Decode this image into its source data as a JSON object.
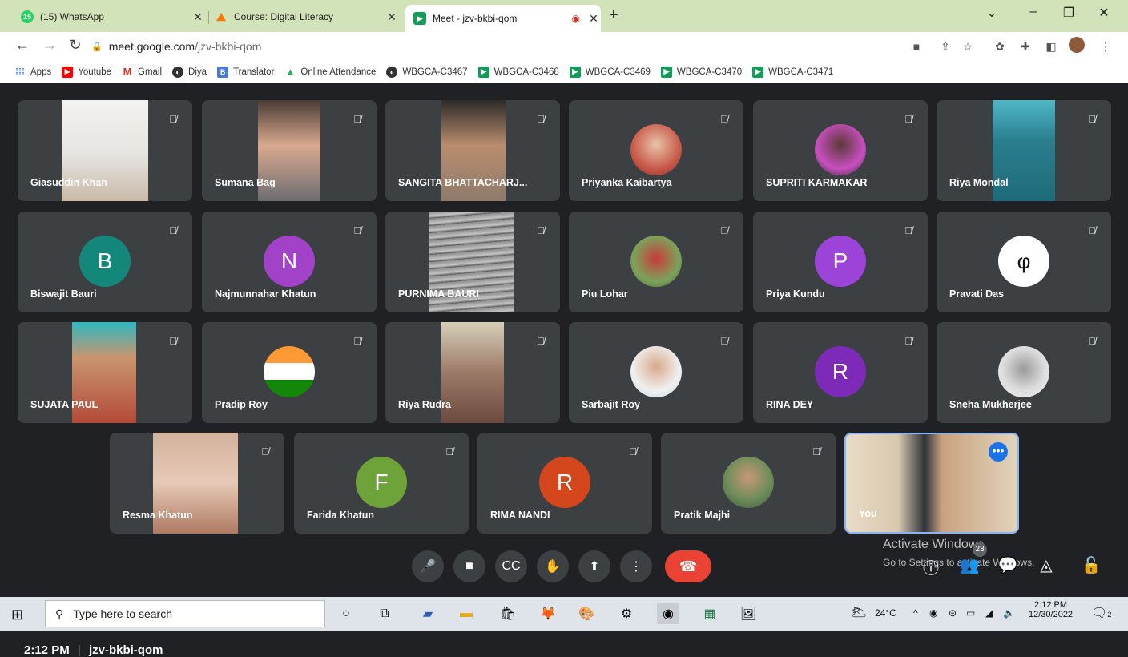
{
  "browser": {
    "tabs": [
      {
        "title": "(15) WhatsApp",
        "badge": "15"
      },
      {
        "title": "Course: Digital Literacy"
      },
      {
        "title": "Meet - jzv-bkbi-qom"
      }
    ],
    "url_host": "meet.google.com",
    "url_path": "/jzv-bkbi-qom",
    "bookmarks": [
      "Apps",
      "Youtube",
      "Gmail",
      "Diya",
      "Translator",
      "Online Attendance",
      "WBGCA-C3467",
      "WBGCA-C3468",
      "WBGCA-C3469",
      "WBGCA-C3470",
      "WBGCA-C3471"
    ]
  },
  "meet": {
    "participants": [
      {
        "name": "Giasuddin Khan",
        "initial": "",
        "color": ""
      },
      {
        "name": "Sumana Bag",
        "initial": "",
        "color": ""
      },
      {
        "name": "SANGITA BHATTACHARJ...",
        "initial": "",
        "color": ""
      },
      {
        "name": "Priyanka Kaibartya",
        "initial": "",
        "color": ""
      },
      {
        "name": "SUPRITI KARMAKAR",
        "initial": "",
        "color": ""
      },
      {
        "name": "Riya Mondal",
        "initial": "",
        "color": ""
      },
      {
        "name": "Biswajit Bauri",
        "initial": "B",
        "color": "#13887a"
      },
      {
        "name": "Najmunnahar Khatun",
        "initial": "N",
        "color": "#a142c8"
      },
      {
        "name": "PURNIMA BAURI",
        "initial": "",
        "color": ""
      },
      {
        "name": "Piu Lohar",
        "initial": "",
        "color": ""
      },
      {
        "name": "Priya Kundu",
        "initial": "P",
        "color": "#9c43d8"
      },
      {
        "name": "Pravati Das",
        "initial": "",
        "color": ""
      },
      {
        "name": "SUJATA PAUL",
        "initial": "",
        "color": ""
      },
      {
        "name": "Pradip Roy",
        "initial": "",
        "color": ""
      },
      {
        "name": "Riya Rudra",
        "initial": "",
        "color": ""
      },
      {
        "name": "Sarbajit Roy",
        "initial": "",
        "color": ""
      },
      {
        "name": "RINA DEY",
        "initial": "R",
        "color": "#7d2ab8"
      },
      {
        "name": "Sneha Mukherjee",
        "initial": "",
        "color": ""
      },
      {
        "name": "Resma Khatun",
        "initial": "",
        "color": ""
      },
      {
        "name": "Farida Khatun",
        "initial": "F",
        "color": "#6ea33a"
      },
      {
        "name": "RIMA NANDI",
        "initial": "R",
        "color": "#d4461c"
      },
      {
        "name": "Pratik Majhi",
        "initial": "",
        "color": ""
      },
      {
        "name": "You",
        "initial": "",
        "color": ""
      }
    ],
    "time": "2:12 PM",
    "separator": "|",
    "meeting_code": "jzv-bkbi-qom",
    "participant_count": "23",
    "watermark_line1": "Activate Windows",
    "watermark_line2": "Go to Settings to activate Windows."
  },
  "taskbar": {
    "search_placeholder": "Type here to search",
    "temperature": "24°C",
    "clock_time": "2:12 PM",
    "clock_date": "12/30/2022",
    "notifications": "2"
  }
}
